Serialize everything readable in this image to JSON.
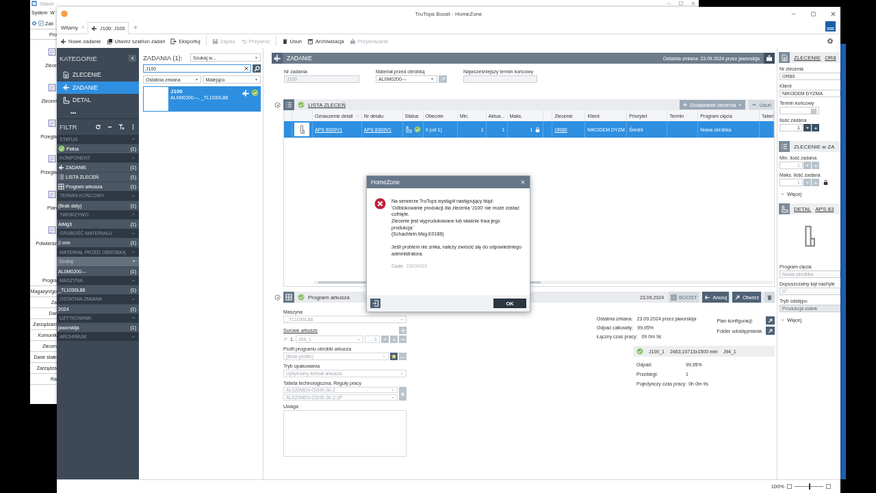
{
  "background_window": {
    "title": "Oseon",
    "menu": [
      "System",
      "W"
    ],
    "toolbar_label": "Zab",
    "tab": "Pro",
    "nav_items": [
      "Zlece",
      "Zleceni",
      "Przegla",
      "Przegla",
      "Plan",
      "Potwierdz"
    ],
    "buttons": [
      "Progra",
      "Magazyn/go",
      "Za",
      "Dar",
      "Zarządzani",
      "Komunik",
      "Zlecen",
      "Dane stałe",
      "Zarządza",
      "Ra"
    ]
  },
  "window": {
    "title": "TruTops Boost - HomeZone"
  },
  "tabs": [
    {
      "label": "Witamy",
      "selected": false,
      "closable": true
    },
    {
      "label": "J100: J100",
      "selected": true,
      "closable": false
    }
  ],
  "toolbar": [
    {
      "label": "Nowe zadanie",
      "kind": "task",
      "disabled": false
    },
    {
      "label": "Utwórz szablon zadań",
      "kind": "template",
      "disabled": false
    },
    {
      "label": "Eksportuj",
      "kind": "export",
      "disabled": false
    },
    {
      "kind": "separator"
    },
    {
      "label": "Zapisz",
      "kind": "save",
      "disabled": true
    },
    {
      "label": "Przywróć",
      "kind": "undo",
      "disabled": true
    },
    {
      "kind": "separator"
    },
    {
      "label": "Usuń",
      "kind": "trash",
      "disabled": false
    },
    {
      "label": "Archiwizacja",
      "kind": "archive",
      "disabled": false
    },
    {
      "label": "Przywracanie",
      "kind": "restore",
      "disabled": true
    }
  ],
  "categories": {
    "title": "KATEGORIE",
    "items": [
      {
        "label": "ZLECENIE",
        "kind": "doc",
        "selected": false
      },
      {
        "label": "ZADANIE",
        "kind": "task",
        "selected": true
      },
      {
        "label": "DETAL",
        "kind": "detail",
        "selected": false
      }
    ],
    "more": "•••"
  },
  "filter": {
    "title": "FILTR",
    "groups": [
      {
        "title": "STATUS",
        "expanded": true,
        "items": [
          {
            "label": "Pełna",
            "count": "(1)",
            "kind": "status"
          }
        ]
      },
      {
        "title": "KOMPONENT",
        "expanded": true,
        "items": [
          {
            "label": "ZADANIE",
            "count": "(1)",
            "kind": "task"
          },
          {
            "label": "LISTA ZLECEŃ",
            "count": "(1)",
            "kind": "list"
          },
          {
            "label": "Program arkusza",
            "count": "(1)",
            "kind": "sheet"
          }
        ]
      },
      {
        "title": "TERMIN KOŃCOWY",
        "expanded": true,
        "items": [
          {
            "label": "(Brak daty)",
            "count": "(1)",
            "kind": "plain"
          }
        ]
      },
      {
        "title": "TWORZYWO",
        "expanded": true,
        "items": [
          {
            "label": "AlMg3",
            "count": "(1)",
            "kind": "plain"
          }
        ]
      },
      {
        "title": "GRUBOŚĆ MATERIAŁU",
        "expanded": true,
        "items": [
          {
            "label": "2 mm",
            "count": "(1)",
            "kind": "plain"
          }
        ]
      },
      {
        "title": "MATERIAŁ PRZED OBRÓBKĄ",
        "expanded": true,
        "search": {
          "placeholder": "Szukaj"
        },
        "items": [
          {
            "label": "AL0M0200---",
            "count": "(1)",
            "kind": "plain"
          }
        ]
      },
      {
        "title": "MASZYNA",
        "expanded": true,
        "items": [
          {
            "label": "_TL1030L88",
            "count": "(1)",
            "kind": "plain"
          }
        ]
      },
      {
        "title": "OSTATNIA ZMIANA",
        "expanded": true,
        "items": [
          {
            "label": "2024",
            "count": "(1)",
            "kind": "plain"
          }
        ]
      },
      {
        "title": "UŻYTKOWNIK",
        "expanded": true,
        "items": [
          {
            "label": "jaworskija",
            "count": "(1)",
            "kind": "plain"
          }
        ]
      },
      {
        "title": "ARCHIWUM",
        "expanded": false
      }
    ]
  },
  "task_list": {
    "title": "ZADANIA (1):",
    "search_in": "Szukaj w...",
    "query": "J100",
    "sort_by": "Ostatnia zmiana",
    "order": "Malejąco",
    "results": [
      {
        "name": "J100",
        "details": "AL0M0200---, _TL1030L88",
        "selected": true
      }
    ]
  },
  "task": {
    "title": "ZADANIE",
    "last_change": "Ostatnia zmiana: 23.09.2024 przez jaworskija",
    "fields": [
      {
        "label": "Nr zadania",
        "value": "J100",
        "kind": "readonly"
      },
      {
        "label": "Materiał przed obróbką",
        "value": "AL0M0200---",
        "kind": "dropdown"
      },
      {
        "label": "Najwcześniejszy termin końcowy",
        "kind": "readonly"
      }
    ]
  },
  "order_list": {
    "title": "LISTA ZLECEŃ",
    "add_button": "Dodawanie zlecenia",
    "remove_button": "Usuń",
    "columns": [
      {
        "kind": "blank"
      },
      {
        "kind": "blank"
      },
      {
        "kind": "label",
        "label": "Oznaczenie detali",
        "sorted": true
      },
      {
        "kind": "label",
        "label": "Nr detalu"
      },
      {
        "kind": "label",
        "label": "Status"
      },
      {
        "kind": "label",
        "label": "Obecnie"
      },
      {
        "kind": "label",
        "label": "Min."
      },
      {
        "kind": "label",
        "label": "Aktua..."
      },
      {
        "kind": "label",
        "label": "Maks."
      },
      {
        "kind": "blank"
      },
      {
        "kind": "label",
        "label": "Zlecenie"
      },
      {
        "kind": "label",
        "label": "Klient"
      },
      {
        "kind": "label",
        "label": "Priorytet"
      },
      {
        "kind": "label",
        "label": "Termin"
      },
      {
        "kind": "label",
        "label": "Program cięcia"
      },
      {
        "kind": "label",
        "label": "Tabel"
      }
    ],
    "rows": [
      {
        "selected": true,
        "cells": [
          {
            "kind": "blank"
          },
          {
            "kind": "thumb"
          },
          {
            "kind": "link",
            "text": "APS 8300V1"
          },
          {
            "kind": "link",
            "text": "APS 8300V1"
          },
          {
            "kind": "status"
          },
          {
            "kind": "text",
            "text": "0 (od 1)"
          },
          {
            "kind": "number",
            "text": "1"
          },
          {
            "kind": "number",
            "text": "1"
          },
          {
            "kind": "number",
            "text": "1",
            "locked": true
          },
          {
            "kind": "blank"
          },
          {
            "kind": "link",
            "text": "OR80"
          },
          {
            "kind": "text",
            "text": "NIKODEM DYZM"
          },
          {
            "kind": "text",
            "text": "Średni"
          },
          {
            "kind": "blank"
          },
          {
            "kind": "text",
            "text": "Nowa obróbka"
          },
          {
            "kind": "blank"
          }
        ]
      }
    ]
  },
  "sheet_program": {
    "title": "Program arkusza",
    "date": "23.09.2024",
    "buttons": [
      {
        "label": "BOOST",
        "kind": "boost",
        "disabled": true
      },
      {
        "label": "Anuluj",
        "kind": "back",
        "disabled": false
      },
      {
        "label": "Otwórz",
        "kind": "open",
        "disabled": false
      },
      {
        "kind": "trash",
        "disabled": true
      }
    ],
    "machine": {
      "label": "Maszyna",
      "value": "_TL1030L88"
    },
    "raw_sheets": {
      "label": "Surowe arkusze",
      "items": [
        {
          "index": "1.",
          "value": "J94_1",
          "quantity": "1"
        }
      ]
    },
    "profile": {
      "label": "Profil programu obróbki arkusza",
      "value": "(Brak profilu)"
    },
    "packing": {
      "label": "Tryb upakowania",
      "value": "Optymalny format arkusza"
    },
    "tech_table": {
      "label": "Tabela technologiczna, Reguły pracy",
      "values": [
        "AL020MD0-O2H0-30-2",
        "AL020MD0-O2H0-30-2:1P"
      ]
    },
    "note": {
      "label": "Uwaga"
    },
    "info": [
      {
        "label": "Ostatnia zmiana:",
        "value": "23.09.2024 przez jaworskija"
      },
      {
        "label": "Odpad całkowity:",
        "value": "99,95%"
      },
      {
        "label": "Łączny czas pracy:",
        "value": "0h 0m 9s"
      }
    ],
    "links": [
      "Plan konfiguracji",
      "Folder udostępniania"
    ],
    "sheet": {
      "name": "J100_1",
      "size": "2463,10713x1500 mm",
      "raw": "J94_1",
      "stats": [
        {
          "label": "Odpad:",
          "value": "99,95%",
          "kind": "column"
        },
        {
          "label": "Przebiegi:",
          "value": "1",
          "kind": "column"
        },
        {
          "label": "Pojedynczy czas pracy:",
          "value": "0h 0m 9s",
          "kind": "inline"
        }
      ]
    }
  },
  "order_panel": {
    "title": "ZLECENIE",
    "title_value": "OR8",
    "fields": [
      {
        "label": "Nr zlecenia",
        "value": "OR80",
        "kind": "text"
      },
      {
        "label": "Klient",
        "value": "NIKODEM DYZMA",
        "kind": "text"
      },
      {
        "label": "Termin końcowy",
        "kind": "date"
      },
      {
        "label": "Ilość zadana",
        "value": "1",
        "kind": "spin",
        "disabled": false,
        "locked": false
      }
    ]
  },
  "in_task_panel": {
    "title": "ZLECENIE w ZA",
    "fields": [
      {
        "label": "Min. ilość zadana",
        "value": "1",
        "kind": "spin",
        "disabled": true,
        "locked": false
      },
      {
        "label": "Maks. ilość zadana",
        "value": "1",
        "kind": "spin",
        "disabled": true,
        "locked": true
      }
    ],
    "more": "Więcej"
  },
  "detail_panel": {
    "title": "DETAL",
    "title_value": "APS 83",
    "fields": [
      {
        "label": "Program cięcia",
        "value": "Nowa obróbka",
        "kind": "readonly"
      },
      {
        "label": "Dopuszczalny kąt nachyle",
        "value": "0°",
        "kind": "readonly"
      },
      {
        "label": "Tryb odstępu",
        "value": "Produkcja siatek",
        "kind": "dropdown"
      }
    ],
    "more": "Więcej"
  },
  "dialog": {
    "title": "HomeZone",
    "message": "Na serwerze TruTops wystąpił następujący błąd:\n'Odblokowanie produkcji dla zlecenia 'J100' nie może zostać cofnięte.\nZlecenie jest wyprodukowane lub właśnie trwa jego produkcja.'\n(Schachteln.Msg.E0186)",
    "hint": "Jeśli problem nie znika, należy zwrócić się do odpowiedniego administratora.",
    "code_label": "Code",
    "code": "23000001",
    "ok": "OK"
  },
  "status_bar": {
    "zoom": "100%",
    "level": 0.5
  }
}
